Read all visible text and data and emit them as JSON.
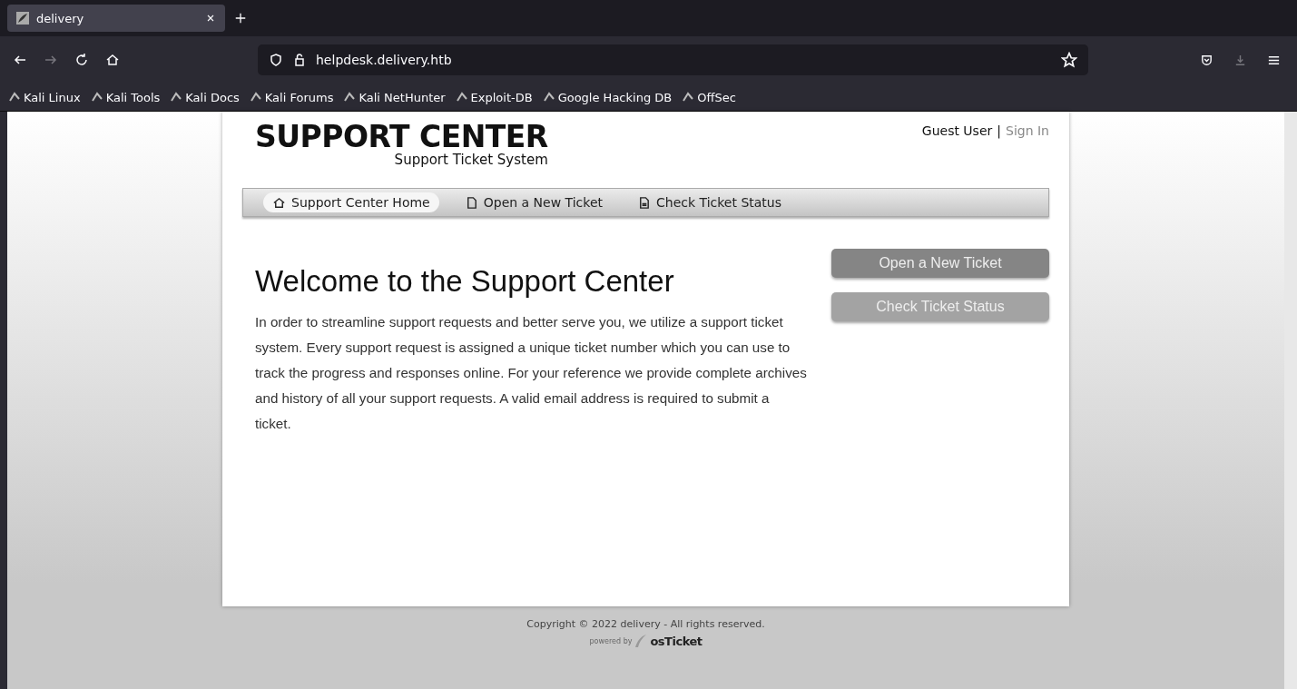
{
  "browser": {
    "tab": {
      "title": "delivery",
      "selected": true
    },
    "url": "helpdesk.delivery.htb",
    "bookmarks": [
      {
        "label": "Kali Linux"
      },
      {
        "label": "Kali Tools"
      },
      {
        "label": "Kali Docs"
      },
      {
        "label": "Kali Forums"
      },
      {
        "label": "Kali NetHunter"
      },
      {
        "label": "Exploit-DB"
      },
      {
        "label": "Google Hacking DB"
      },
      {
        "label": "OffSec"
      }
    ]
  },
  "header": {
    "title": "SUPPORT CENTER",
    "subtitle": "Support Ticket System",
    "user": "Guest User",
    "separator": "|",
    "sign_in": "Sign In"
  },
  "nav": [
    {
      "label": "Support Center Home",
      "kind": "home",
      "selected": true
    },
    {
      "label": "Open a New Ticket",
      "kind": "new",
      "selected": false
    },
    {
      "label": "Check Ticket Status",
      "kind": "status",
      "selected": false
    }
  ],
  "welcome": {
    "title": "Welcome to the Support Center",
    "text": "In order to streamline support requests and better serve you, we utilize a support ticket system. Every support request is assigned a unique ticket number which you can use to track the progress and responses online. For your reference we provide complete archives and history of all your support requests. A valid email address is required to submit a ticket."
  },
  "buttons": [
    {
      "label": "Open a New Ticket",
      "kind": "primary"
    },
    {
      "label": "Check Ticket Status",
      "kind": "secondary"
    }
  ],
  "footer": {
    "copyright": "Copyright © 2022 delivery - All rights reserved.",
    "powered_by": "powered by",
    "logo": "osTicket"
  }
}
